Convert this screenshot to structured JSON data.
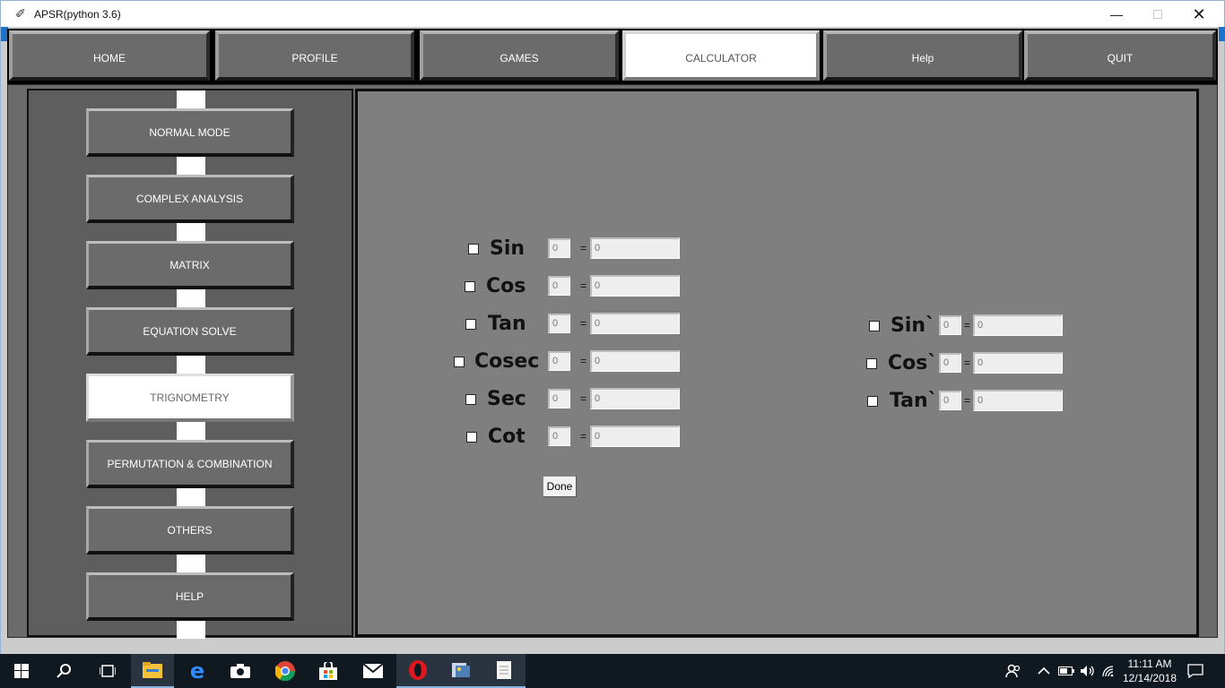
{
  "window": {
    "title": "APSR(python 3.6)",
    "controls": {
      "minimize": "—",
      "close": "✕"
    }
  },
  "nav": {
    "tabs": [
      {
        "label": "HOME",
        "active": false
      },
      {
        "label": "PROFILE",
        "active": false
      },
      {
        "label": "GAMES",
        "active": false
      },
      {
        "label": "CALCULATOR",
        "active": true
      },
      {
        "label": "Help",
        "active": false
      },
      {
        "label": "QUIT",
        "active": false
      }
    ]
  },
  "sidebar": {
    "items": [
      {
        "label": "NORMAL MODE",
        "active": false
      },
      {
        "label": "COMPLEX ANALYSIS",
        "active": false
      },
      {
        "label": "MATRIX",
        "active": false
      },
      {
        "label": "EQUATION SOLVE",
        "active": false
      },
      {
        "label": "TRIGNOMETRY",
        "active": true
      },
      {
        "label": "PERMUTATION & COMBINATION",
        "active": false
      },
      {
        "label": "OTHERS",
        "active": false
      },
      {
        "label": "HELP",
        "active": false
      }
    ]
  },
  "trig": {
    "functions": [
      {
        "name": "Sin",
        "input": "0",
        "result": "0",
        "checked": false
      },
      {
        "name": "Cos",
        "input": "0",
        "result": "0",
        "checked": false
      },
      {
        "name": "Tan",
        "input": "0",
        "result": "0",
        "checked": false
      },
      {
        "name": "Cosec",
        "input": "0",
        "result": "0",
        "checked": false
      },
      {
        "name": "Sec",
        "input": "0",
        "result": "0",
        "checked": false
      },
      {
        "name": "Cot",
        "input": "0",
        "result": "0",
        "checked": false
      }
    ],
    "inverse": [
      {
        "name": "Sin`",
        "input": "0",
        "result": "0",
        "checked": false
      },
      {
        "name": "Cos`",
        "input": "0",
        "result": "0",
        "checked": false
      },
      {
        "name": "Tan`",
        "input": "0",
        "result": "0",
        "checked": false
      }
    ],
    "equals": "=",
    "done_label": "Done"
  },
  "taskbar": {
    "apps": [
      "windows-start-icon",
      "search-icon",
      "task-view-icon",
      "file-explorer-icon",
      "edge-browser-icon",
      "camera-icon",
      "chrome-icon",
      "store-icon",
      "mail-icon",
      "opera-icon",
      "python-idle-icon",
      "notepad-icon"
    ],
    "tray": [
      "people-icon",
      "chevron-up-icon",
      "battery-icon",
      "volume-icon",
      "wifi-icon",
      "notification-icon"
    ],
    "time": "11:11 AM",
    "date": "12/14/2018"
  }
}
